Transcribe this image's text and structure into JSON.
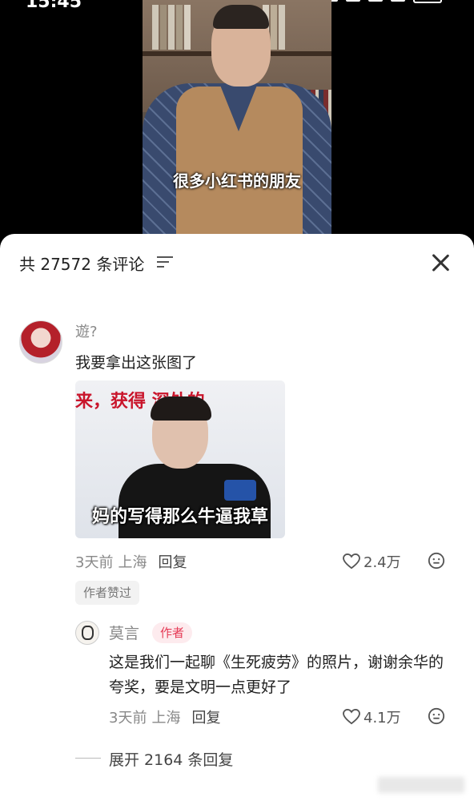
{
  "status_bar": {
    "time": "15:45",
    "battery": "100"
  },
  "video": {
    "subtitle": "很多小红书的朋友"
  },
  "comments_panel": {
    "title": "共 27572 条评论",
    "comments": [
      {
        "username": "遊?",
        "text": "我要拿出这张图了",
        "image_caption_top": "来，获得  深处的",
        "image_caption": "妈的写得那么牛逼我草",
        "time": "3天前",
        "location": "上海",
        "reply_label": "回复",
        "likes": "2.4万",
        "badge": "作者赞过"
      }
    ],
    "reply": {
      "username": "莫言",
      "author_tag": "作者",
      "text": "这是我们一起聊《生死疲劳》的照片，谢谢余华的夸奖，要是文明一点更好了",
      "time": "3天前",
      "location": "上海",
      "reply_label": "回复",
      "likes": "4.1万"
    },
    "expand_label": "展开 2164 条回复"
  }
}
